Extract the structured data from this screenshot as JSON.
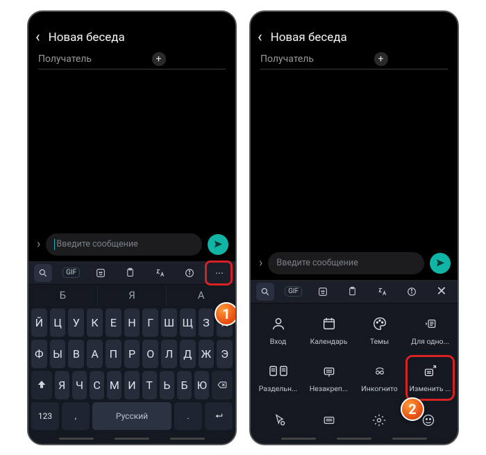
{
  "header": {
    "title": "Новая беседа"
  },
  "recipient": {
    "label": "Получатель"
  },
  "composer": {
    "placeholder": "Введите сообщение"
  },
  "predictions": [
    "Б",
    "Я",
    "А"
  ],
  "keyboard": {
    "row1": [
      "Й",
      "Ц",
      "У",
      "К",
      "Е",
      "Н",
      "Г",
      "Ш",
      "Щ",
      "З",
      "Х"
    ],
    "row2": [
      "Ф",
      "Ы",
      "В",
      "А",
      "П",
      "Р",
      "О",
      "Л",
      "Д",
      "Ж",
      "Э"
    ],
    "row3_mid": [
      "Я",
      "Ч",
      "С",
      "М",
      "И",
      "Т",
      "Ь",
      "Б",
      "Ю"
    ],
    "num_label": "123",
    "lang_label": "Русский"
  },
  "options": {
    "r1": [
      {
        "label": "Вход"
      },
      {
        "label": "Календарь"
      },
      {
        "label": "Темы"
      },
      {
        "label": "Для одно..."
      }
    ],
    "r2": [
      {
        "label": "Раздельн..."
      },
      {
        "label": "Незакреп..."
      },
      {
        "label": "Инкогнито"
      },
      {
        "label": "Изменить ..."
      }
    ]
  },
  "badges": {
    "one": "1",
    "two": "2"
  },
  "colors": {
    "accent": "#11b5a6",
    "highlight": "#d62222",
    "badge": "#e64a0e"
  }
}
